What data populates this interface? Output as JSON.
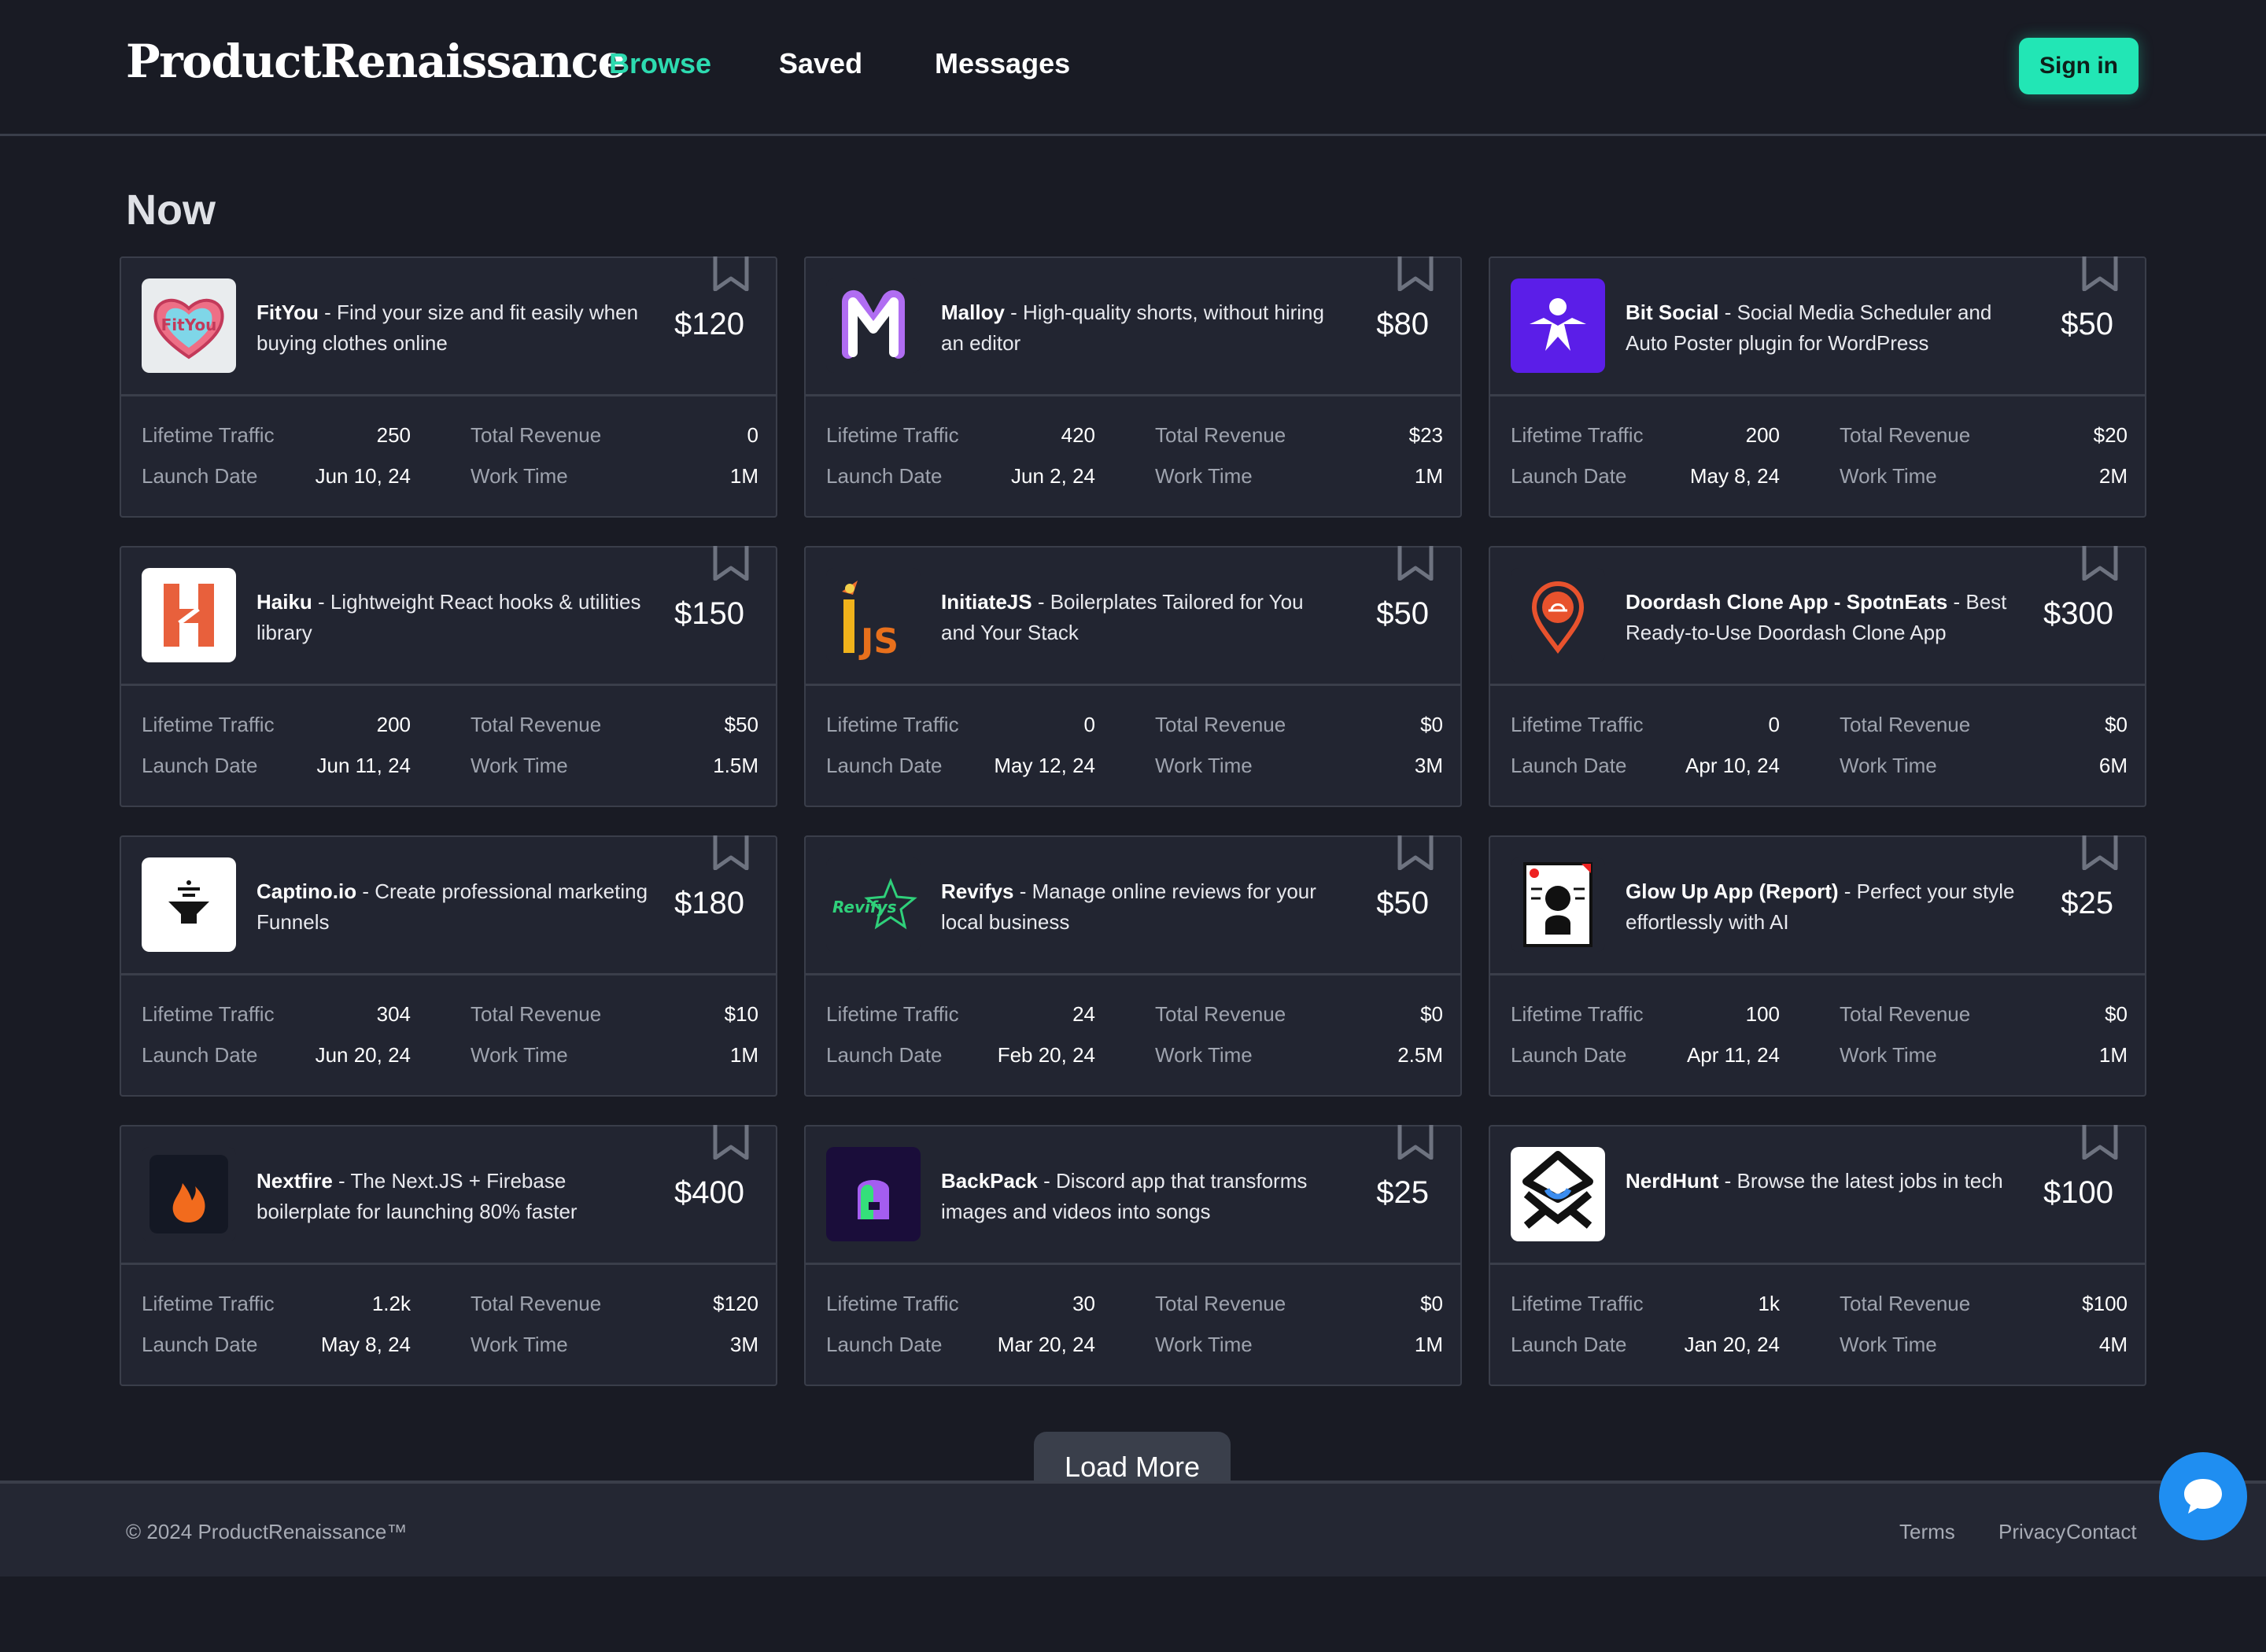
{
  "header": {
    "brand": "ProductRenaissance",
    "nav": [
      {
        "label": "Browse",
        "active": true
      },
      {
        "label": "Saved",
        "active": false
      },
      {
        "label": "Messages",
        "active": false
      }
    ],
    "sign_in": "Sign in"
  },
  "section": {
    "title": "Now"
  },
  "stat_labels": {
    "traffic": "Lifetime Traffic",
    "revenue": "Total Revenue",
    "launch": "Launch Date",
    "work": "Work Time"
  },
  "products": [
    {
      "name": "FitYou",
      "tagline": " - Find your size and fit easily when buying clothes online",
      "price": "$120",
      "traffic": "250",
      "revenue": "0",
      "launch": "Jun 10, 24",
      "work": "1M",
      "logo": "fityou-heart-logo"
    },
    {
      "name": "Malloy",
      "tagline": " - High-quality shorts, without hiring an editor",
      "price": "$80",
      "traffic": "420",
      "revenue": "$23",
      "launch": "Jun 2, 24",
      "work": "1M",
      "logo": "malloy-m-logo"
    },
    {
      "name": "Bit Social",
      "tagline": " - Social Media Scheduler and Auto Poster plugin for WordPress",
      "price": "$50",
      "traffic": "200",
      "revenue": "$20",
      "launch": "May 8, 24",
      "work": "2M",
      "logo": "bitsocial-logo"
    },
    {
      "name": "Haiku",
      "tagline": " - Lightweight React hooks & utilities library",
      "price": "$150",
      "traffic": "200",
      "revenue": "$50",
      "launch": "Jun 11, 24",
      "work": "1.5M",
      "logo": "haiku-h-logo"
    },
    {
      "name": "InitiateJS",
      "tagline": " - Boilerplates Tailored for You and Your Stack",
      "price": "$50",
      "traffic": "0",
      "revenue": "$0",
      "launch": "May 12, 24",
      "work": "3M",
      "logo": "initiatejs-logo"
    },
    {
      "name": "Doordash Clone App - SpotnEats",
      "tagline": " - Best Ready-to-Use Doordash Clone App",
      "price": "$300",
      "traffic": "0",
      "revenue": "$0",
      "launch": "Apr 10, 24",
      "work": "6M",
      "logo": "map-pin-logo"
    },
    {
      "name": "Captino.io",
      "tagline": " - Create professional marketing Funnels",
      "price": "$180",
      "traffic": "304",
      "revenue": "$10",
      "launch": "Jun 20, 24",
      "work": "1M",
      "logo": "funnel-logo"
    },
    {
      "name": "Revifys",
      "tagline": " - Manage online reviews for your local business",
      "price": "$50",
      "traffic": "24",
      "revenue": "$0",
      "launch": "Feb 20, 24",
      "work": "2.5M",
      "logo": "revifys-star-logo"
    },
    {
      "name": "Glow Up App (Report)",
      "tagline": " - Perfect your style effortlessly with AI",
      "price": "$25",
      "traffic": "100",
      "revenue": "$0",
      "launch": "Apr 11, 24",
      "work": "1M",
      "logo": "report-face-logo"
    },
    {
      "name": "Nextfire",
      "tagline": " - The Next.JS + Firebase boilerplate for launching 80% faster",
      "price": "$400",
      "traffic": "1.2k",
      "revenue": "$120",
      "launch": "May 8, 24",
      "work": "3M",
      "logo": "flame-logo"
    },
    {
      "name": "BackPack",
      "tagline": " - Discord app that transforms images and videos into songs",
      "price": "$25",
      "traffic": "30",
      "revenue": "$0",
      "launch": "Mar 20, 24",
      "work": "1M",
      "logo": "backpack-logo"
    },
    {
      "name": "NerdHunt",
      "tagline": " - Browse the latest jobs in tech",
      "price": "$100",
      "traffic": "1k",
      "revenue": "$100",
      "launch": "Jan 20, 24",
      "work": "4M",
      "logo": "nerdhunt-logo"
    }
  ],
  "load_more": "Load More",
  "footer": {
    "copyright": "© 2024 ProductRenaissance™",
    "links": [
      "Terms",
      "Privacy",
      "Contact"
    ]
  },
  "colors": {
    "accent": "#22e6b5",
    "background": "#191b24",
    "card": "#222531",
    "chat": "#1f8ef1"
  }
}
